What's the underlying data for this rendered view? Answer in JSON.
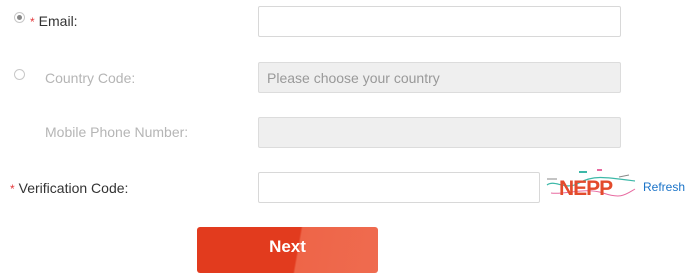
{
  "form": {
    "email": {
      "required_mark": "*",
      "label": "Email:",
      "value": "",
      "placeholder": "",
      "selected": true
    },
    "country_code": {
      "label": "Country Code:",
      "value": "",
      "placeholder": "Please choose your country",
      "selected": false
    },
    "mobile_phone": {
      "label": "Mobile Phone Number:",
      "value": ""
    },
    "verification": {
      "required_mark": "*",
      "label": "Verification Code:",
      "value": "",
      "captcha_text": "NEPP",
      "refresh_label": "Refresh"
    },
    "next_label": "Next"
  },
  "colors": {
    "required": "#e4393c",
    "link": "#1a73c8",
    "button": "#e23b1e",
    "disabled_text": "#b5b5b5"
  }
}
